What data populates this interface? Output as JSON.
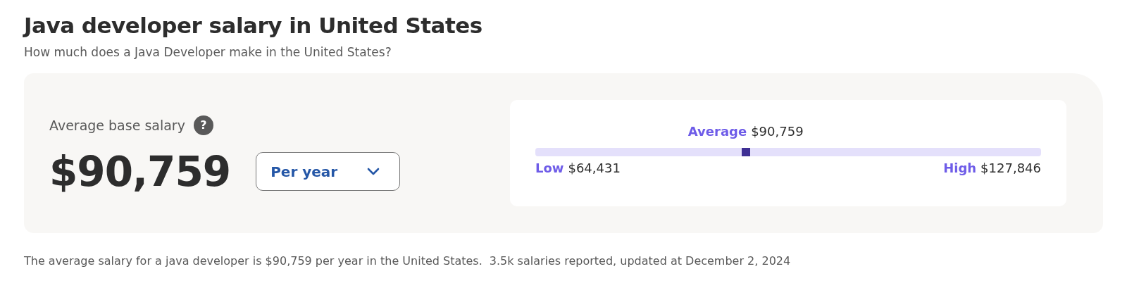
{
  "title": "Java developer salary in United States",
  "subtitle": "How much does a Java Developer make in the United States?",
  "summary": {
    "label": "Average base salary",
    "help_icon": "?",
    "amount": "$90,759",
    "period": {
      "value": "Per year"
    }
  },
  "range": {
    "average_label": "Average",
    "average_value": "$90,759",
    "level": 0.416,
    "low_label": "Low",
    "low_value": "$64,431",
    "high_label": "High",
    "high_value": "$127,846"
  },
  "footer": [
    "The average salary for a java developer is $90,759 per year in the United States.",
    "3.5k salaries reported, updated at December 2, 2024"
  ]
}
